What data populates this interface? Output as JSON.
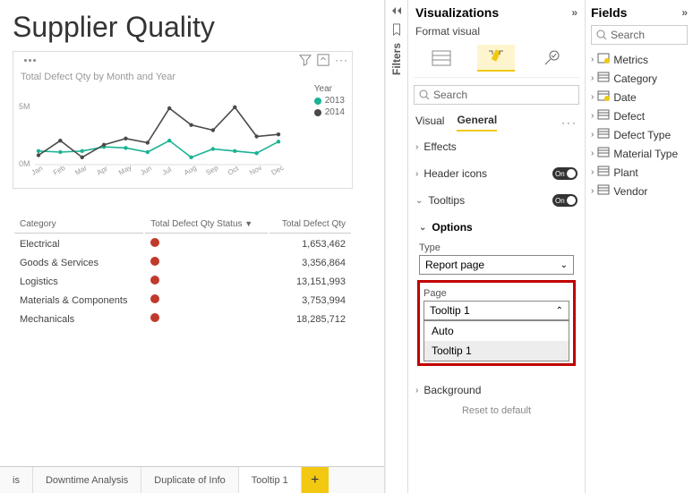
{
  "report": {
    "title": "Supplier Quality"
  },
  "chart": {
    "title": "Total Defect Qty by Month and Year",
    "legend_title": "Year",
    "axis": {
      "y_ticks": [
        "5M",
        "0M"
      ],
      "x_ticks": [
        "Jan",
        "Feb",
        "Mar",
        "Apr",
        "May",
        "Jun",
        "Jul",
        "Aug",
        "Sep",
        "Oct",
        "Nov",
        "Dec"
      ]
    },
    "series": [
      {
        "name": "2013",
        "color": "#1AB394"
      },
      {
        "name": "2014",
        "color": "#4A4A4A"
      }
    ]
  },
  "chart_data": {
    "type": "line",
    "title": "Total Defect Qty by Month and Year",
    "xlabel": "",
    "ylabel": "",
    "ylim": [
      0,
      6000000
    ],
    "categories": [
      "Jan",
      "Feb",
      "Mar",
      "Apr",
      "May",
      "Jun",
      "Jul",
      "Aug",
      "Sep",
      "Oct",
      "Nov",
      "Dec"
    ],
    "series": [
      {
        "name": "2013",
        "values": [
          1300000,
          1200000,
          1300000,
          1700000,
          1600000,
          1200000,
          2300000,
          700000,
          1500000,
          1300000,
          1100000,
          2200000
        ]
      },
      {
        "name": "2014",
        "values": [
          900000,
          2300000,
          700000,
          1900000,
          2500000,
          2100000,
          5400000,
          3800000,
          3300000,
          5500000,
          2700000,
          2900000
        ]
      }
    ]
  },
  "table": {
    "columns": [
      "Category",
      "Total Defect Qty Status",
      "Total Defect Qty"
    ],
    "sort_icon_col": 1,
    "rows": [
      {
        "category": "Electrical",
        "qty": "1,653,462"
      },
      {
        "category": "Goods & Services",
        "qty": "3,356,864"
      },
      {
        "category": "Logistics",
        "qty": "13,151,993"
      },
      {
        "category": "Materials & Components",
        "qty": "3,753,994"
      },
      {
        "category": "Mechanicals",
        "qty": "18,285,712"
      }
    ]
  },
  "page_tabs": {
    "items": [
      "is",
      "Downtime Analysis",
      "Duplicate of Info",
      "Tooltip 1"
    ],
    "active": 3
  },
  "filters_rail": {
    "label": "Filters"
  },
  "viz": {
    "header": "Visualizations",
    "subheader": "Format visual",
    "search_placeholder": "Search",
    "tabs": {
      "visual": "Visual",
      "general": "General"
    },
    "sections": {
      "effects": "Effects",
      "header_icons": "Header icons",
      "tooltips": "Tooltips",
      "background": "Background",
      "reset": "Reset to default"
    },
    "toggle_labels": {
      "on": "On"
    },
    "options": {
      "header": "Options",
      "type_label": "Type",
      "type_value": "Report page",
      "page_label": "Page",
      "page_value": "Tooltip 1",
      "dropdown": [
        "Auto",
        "Tooltip 1"
      ],
      "dropdown_selected": 1
    }
  },
  "fields": {
    "header": "Fields",
    "search_placeholder": "Search",
    "items": [
      {
        "label": "Metrics",
        "kind": "measure"
      },
      {
        "label": "Category",
        "kind": "table"
      },
      {
        "label": "Date",
        "kind": "date"
      },
      {
        "label": "Defect",
        "kind": "table"
      },
      {
        "label": "Defect Type",
        "kind": "table"
      },
      {
        "label": "Material Type",
        "kind": "table"
      },
      {
        "label": "Plant",
        "kind": "table"
      },
      {
        "label": "Vendor",
        "kind": "table"
      }
    ]
  }
}
